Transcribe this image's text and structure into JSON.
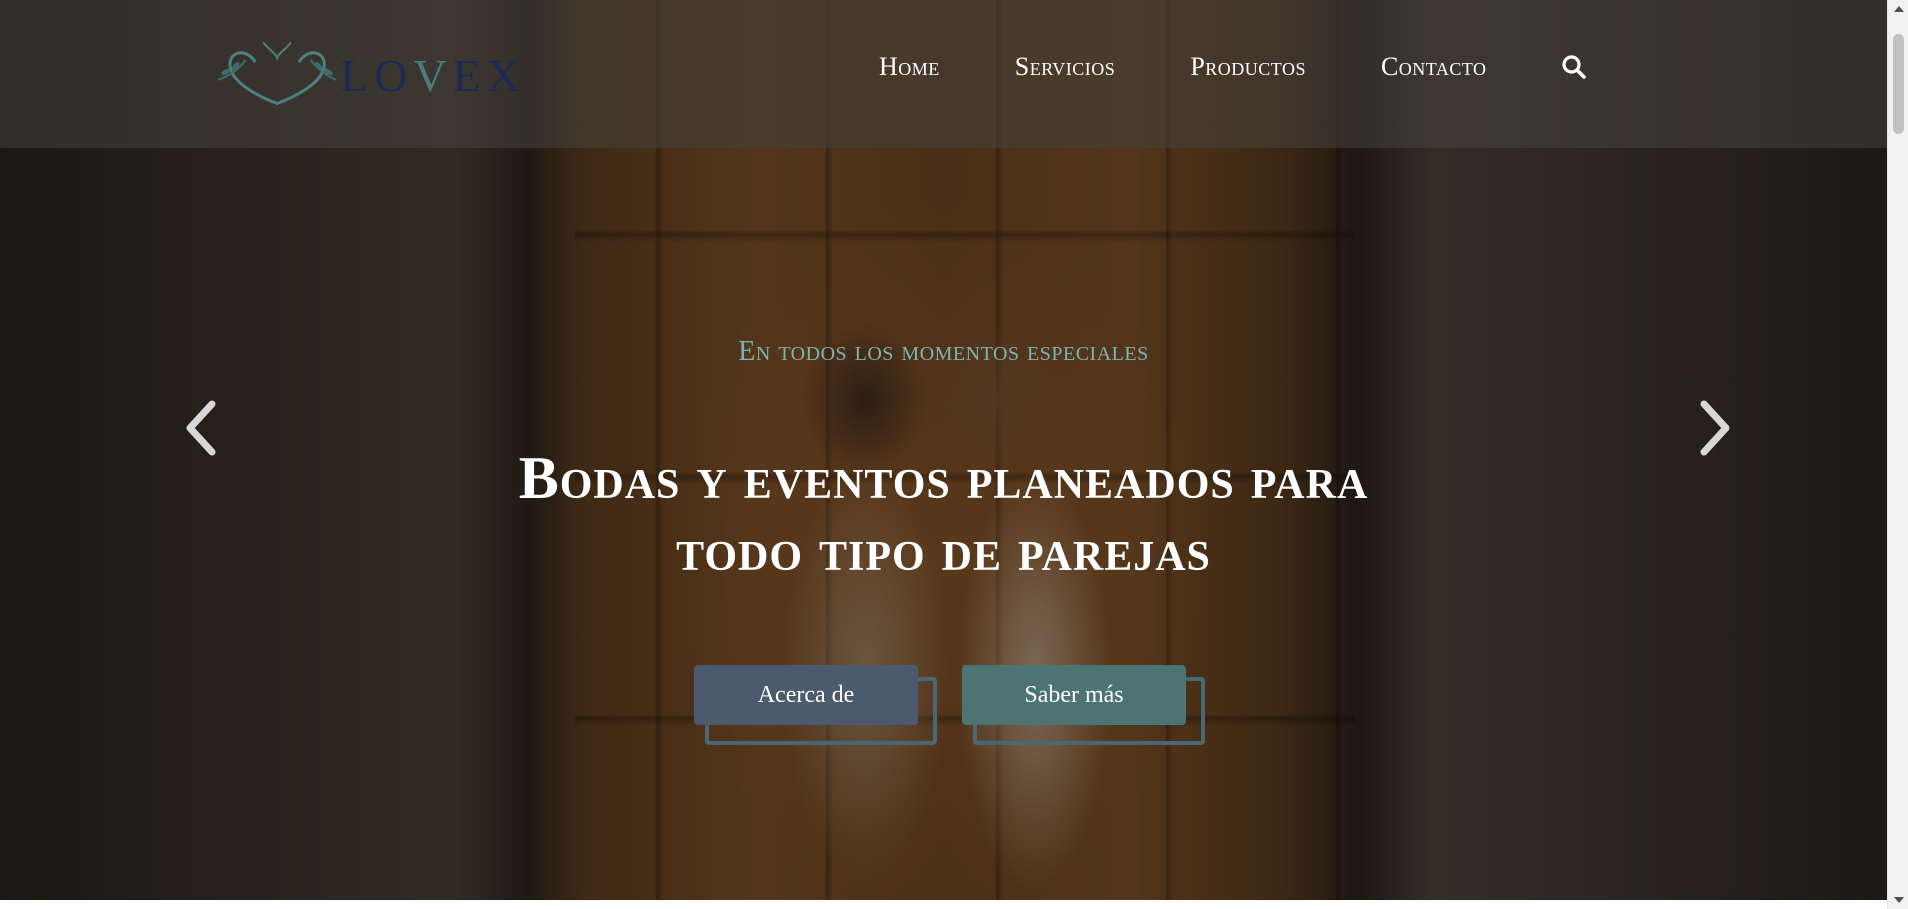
{
  "brand": {
    "name_part1": "LO",
    "name_part2": "V",
    "name_part3": "EX",
    "logo_icon": "heart-vine-icon"
  },
  "nav": {
    "items": [
      "Home",
      "Servicios",
      "Productos",
      "Contacto"
    ],
    "search_icon": "search-icon"
  },
  "hero": {
    "subtitle": "En todos los momentos especiales",
    "title_line1": "Bodas y eventos planeados para",
    "title_line2": "todo tipo de parejas",
    "buttons": {
      "about": "Acerca de",
      "more": "Saber más"
    },
    "prev_icon": "chevron-left-icon",
    "next_icon": "chevron-right-icon"
  },
  "colors": {
    "accent_teal": "#7fb3b3",
    "button_about": "#4b5a6c",
    "button_more": "#4d7474",
    "logo_navy": "#1e2a55"
  }
}
